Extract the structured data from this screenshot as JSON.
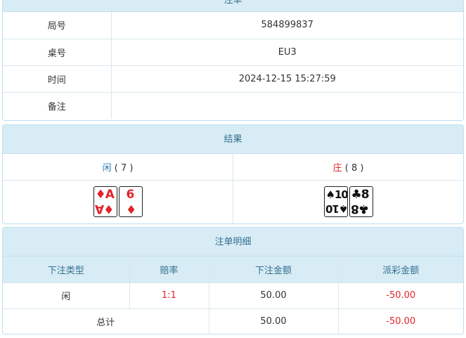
{
  "order": {
    "title": "注单",
    "rows": [
      {
        "label": "局号",
        "value": "584899837"
      },
      {
        "label": "桌号",
        "value": "EU3"
      },
      {
        "label": "时间",
        "value": "2024-12-15 15:27:59"
      },
      {
        "label": "备注",
        "value": ""
      }
    ]
  },
  "result": {
    "title": "结果",
    "player": {
      "name": "闲",
      "score": "( 7 )"
    },
    "banker": {
      "name": "庄",
      "score": "( 8 )"
    },
    "player_cards": [
      {
        "rank": "A",
        "suit": "♦",
        "color": "red"
      },
      {
        "rank": "6",
        "suit": "♦",
        "color": "red"
      }
    ],
    "banker_cards": [
      {
        "rank": "10",
        "suit": "♠",
        "color": "black"
      },
      {
        "rank": "8",
        "suit": "♣",
        "color": "black"
      }
    ],
    "colors": {
      "player": "#2a7ab6",
      "banker": "#e0242a"
    }
  },
  "detail": {
    "title": "注单明细",
    "headers": [
      "下注类型",
      "赔率",
      "下注金额",
      "派彩金额"
    ],
    "rows": [
      {
        "type": "闲",
        "odds": "1:1",
        "amount": "50.00",
        "payout": "-50.00"
      }
    ],
    "total": {
      "label": "总计",
      "amount": "50.00",
      "payout": "-50.00"
    }
  }
}
